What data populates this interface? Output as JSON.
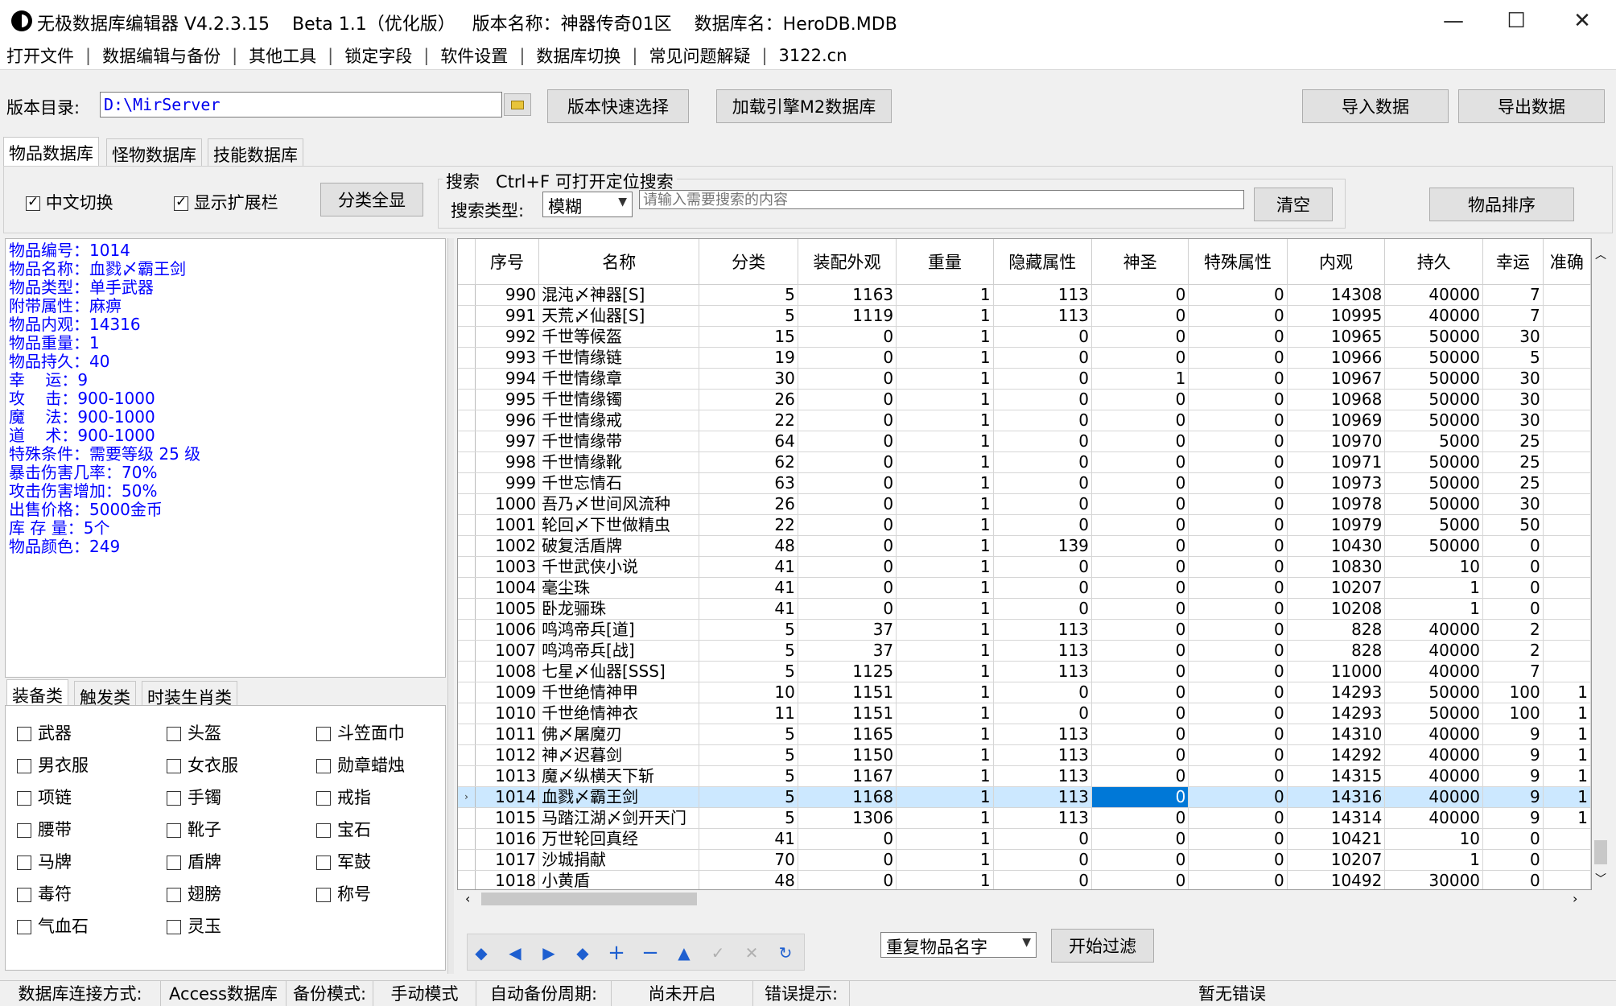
{
  "window": {
    "title": "无极数据库编辑器 V4.2.3.15    Beta 1.1（优化版）   版本名称：神器传奇01区    数据库名：HeroDB.MDB",
    "minimize": "—",
    "maximize": "☐",
    "close": "✕"
  },
  "menu": [
    "打开文件",
    "数据编辑与备份",
    "其他工具",
    "锁定字段",
    "软件设置",
    "数据库切换",
    "常见问题解疑",
    "3122.cn"
  ],
  "toolbar": {
    "dir_label": "版本目录:",
    "dir_value": "D:\\MirServer",
    "quick_select": "版本快速选择",
    "load_m2": "加载引擎M2数据库",
    "import": "导入数据",
    "export": "导出数据"
  },
  "tabs": [
    "物品数据库",
    "怪物数据库",
    "技能数据库"
  ],
  "options": {
    "chinese_switch": "中文切换",
    "show_ext": "显示扩展栏",
    "show_all_categories": "分类全显"
  },
  "search": {
    "group_label": "搜索   Ctrl+F 可打开定位搜索",
    "type_label": "搜索类型:",
    "type_value": "模糊",
    "placeholder": "请输入需要搜索的内容",
    "clear": "清空",
    "sort": "物品排序"
  },
  "detail_lines": [
    "物品编号：1014",
    "物品名称：血戮〆霸王剑",
    "物品类型：单手武器",
    "附带属性：麻痹",
    "物品内观：14316",
    "物品重量：1",
    "物品持久：40",
    "幸    运：9",
    "攻    击：900-1000",
    "魔    法：900-1000",
    "道    术：900-1000",
    "特殊条件：需要等级 25 级",
    "暴击伤害几率：70%",
    "攻击伤害增加：50%",
    "出售价格：5000金币",
    "库 存 量：5个",
    "物品颜色：249"
  ],
  "category_tabs": [
    "装备类",
    "触发类",
    "时装生肖类"
  ],
  "categories": [
    [
      "武器",
      "头盔",
      "斗笠面巾"
    ],
    [
      "男衣服",
      "女衣服",
      "勋章蜡烛"
    ],
    [
      "项链",
      "手镯",
      "戒指"
    ],
    [
      "腰带",
      "靴子",
      "宝石"
    ],
    [
      "马牌",
      "盾牌",
      "军鼓"
    ],
    [
      "毒符",
      "翅膀",
      "称号"
    ],
    [
      "气血石",
      "灵玉",
      ""
    ]
  ],
  "grid": {
    "columns": [
      "序号",
      "名称",
      "分类",
      "装配外观",
      "重量",
      "隐藏属性",
      "神圣",
      "特殊属性",
      "内观",
      "持久",
      "幸运",
      "准确"
    ],
    "selected_row_index": 24,
    "rows": [
      [
        "990",
        "混沌〆神器[S]",
        "5",
        "1163",
        "1",
        "113",
        "0",
        "0",
        "14308",
        "40000",
        "7",
        ""
      ],
      [
        "991",
        "天荒〆仙器[S]",
        "5",
        "1119",
        "1",
        "113",
        "0",
        "0",
        "10995",
        "40000",
        "7",
        ""
      ],
      [
        "992",
        "千世等候盔",
        "15",
        "0",
        "1",
        "0",
        "0",
        "0",
        "10965",
        "50000",
        "30",
        ""
      ],
      [
        "993",
        "千世情缘链",
        "19",
        "0",
        "1",
        "0",
        "0",
        "0",
        "10966",
        "50000",
        "5",
        ""
      ],
      [
        "994",
        "千世情缘章",
        "30",
        "0",
        "1",
        "0",
        "1",
        "0",
        "10967",
        "50000",
        "30",
        ""
      ],
      [
        "995",
        "千世情缘镯",
        "26",
        "0",
        "1",
        "0",
        "0",
        "0",
        "10968",
        "50000",
        "30",
        ""
      ],
      [
        "996",
        "千世情缘戒",
        "22",
        "0",
        "1",
        "0",
        "0",
        "0",
        "10969",
        "50000",
        "30",
        ""
      ],
      [
        "997",
        "千世情缘带",
        "64",
        "0",
        "1",
        "0",
        "0",
        "0",
        "10970",
        "5000",
        "25",
        ""
      ],
      [
        "998",
        "千世情缘靴",
        "62",
        "0",
        "1",
        "0",
        "0",
        "0",
        "10971",
        "50000",
        "25",
        ""
      ],
      [
        "999",
        "千世忘情石",
        "63",
        "0",
        "1",
        "0",
        "0",
        "0",
        "10973",
        "50000",
        "25",
        ""
      ],
      [
        "1000",
        "吾乃〆世间风流种",
        "26",
        "0",
        "1",
        "0",
        "0",
        "0",
        "10978",
        "50000",
        "30",
        ""
      ],
      [
        "1001",
        "轮回〆下世做精虫",
        "22",
        "0",
        "1",
        "0",
        "0",
        "0",
        "10979",
        "5000",
        "50",
        ""
      ],
      [
        "1002",
        "破复活盾牌",
        "48",
        "0",
        "1",
        "139",
        "0",
        "0",
        "10430",
        "50000",
        "0",
        ""
      ],
      [
        "1003",
        "千世武侠小说",
        "41",
        "0",
        "1",
        "0",
        "0",
        "0",
        "10830",
        "10",
        "0",
        ""
      ],
      [
        "1004",
        "毫尘珠",
        "41",
        "0",
        "1",
        "0",
        "0",
        "0",
        "10207",
        "1",
        "0",
        ""
      ],
      [
        "1005",
        "卧龙骊珠",
        "41",
        "0",
        "1",
        "0",
        "0",
        "0",
        "10208",
        "1",
        "0",
        ""
      ],
      [
        "1006",
        "鸣鸿帝兵[道]",
        "5",
        "37",
        "1",
        "113",
        "0",
        "0",
        "828",
        "40000",
        "2",
        ""
      ],
      [
        "1007",
        "鸣鸿帝兵[战]",
        "5",
        "37",
        "1",
        "113",
        "0",
        "0",
        "828",
        "40000",
        "2",
        ""
      ],
      [
        "1008",
        "七星〆仙器[SSS]",
        "5",
        "1125",
        "1",
        "113",
        "0",
        "0",
        "11000",
        "40000",
        "7",
        ""
      ],
      [
        "1009",
        "千世绝情神甲",
        "10",
        "1151",
        "1",
        "0",
        "0",
        "0",
        "14293",
        "50000",
        "100",
        "1"
      ],
      [
        "1010",
        "千世绝情神衣",
        "11",
        "1151",
        "1",
        "0",
        "0",
        "0",
        "14293",
        "50000",
        "100",
        "1"
      ],
      [
        "1011",
        "佛〆屠魔刃",
        "5",
        "1165",
        "1",
        "113",
        "0",
        "0",
        "14310",
        "40000",
        "9",
        "1"
      ],
      [
        "1012",
        "神〆迟暮剑",
        "5",
        "1150",
        "1",
        "113",
        "0",
        "0",
        "14292",
        "40000",
        "9",
        "1"
      ],
      [
        "1013",
        "魔〆纵横天下斩",
        "5",
        "1167",
        "1",
        "113",
        "0",
        "0",
        "14315",
        "40000",
        "9",
        "1"
      ],
      [
        "1014",
        "血戮〆霸王剑",
        "5",
        "1168",
        "1",
        "113",
        "0",
        "0",
        "14316",
        "40000",
        "9",
        "1"
      ],
      [
        "1015",
        "马踏江湖〆剑开天门",
        "5",
        "1306",
        "1",
        "113",
        "0",
        "0",
        "14314",
        "40000",
        "9",
        "1"
      ],
      [
        "1016",
        "万世轮回真经",
        "41",
        "0",
        "1",
        "0",
        "0",
        "0",
        "10421",
        "10",
        "0",
        ""
      ],
      [
        "1017",
        "沙城捐献",
        "70",
        "0",
        "1",
        "0",
        "0",
        "0",
        "10207",
        "1",
        "0",
        ""
      ],
      [
        "1018",
        "小黄盾",
        "48",
        "0",
        "1",
        "0",
        "0",
        "0",
        "10492",
        "30000",
        "0",
        ""
      ]
    ]
  },
  "filter": {
    "select_value": "重复物品名字",
    "start": "开始过滤"
  },
  "nav_icons": [
    "first-icon",
    "prev-icon",
    "next-icon",
    "last-icon",
    "add-icon",
    "delete-icon",
    "up-icon",
    "confirm-icon",
    "cancel-icon",
    "refresh-icon"
  ],
  "status": {
    "conn_label": "数据库连接方式:",
    "conn_value": "Access数据库",
    "backup_label": "备份模式:",
    "backup_value": "手动模式",
    "auto_label": "自动备份周期:",
    "auto_value": "尚未开启",
    "error_label": "错误提示:",
    "error_value": "暂无错误"
  },
  "colors": {
    "accent": "#0078d7",
    "selection": "#cce8ff",
    "detail_text": "#0000ff"
  }
}
